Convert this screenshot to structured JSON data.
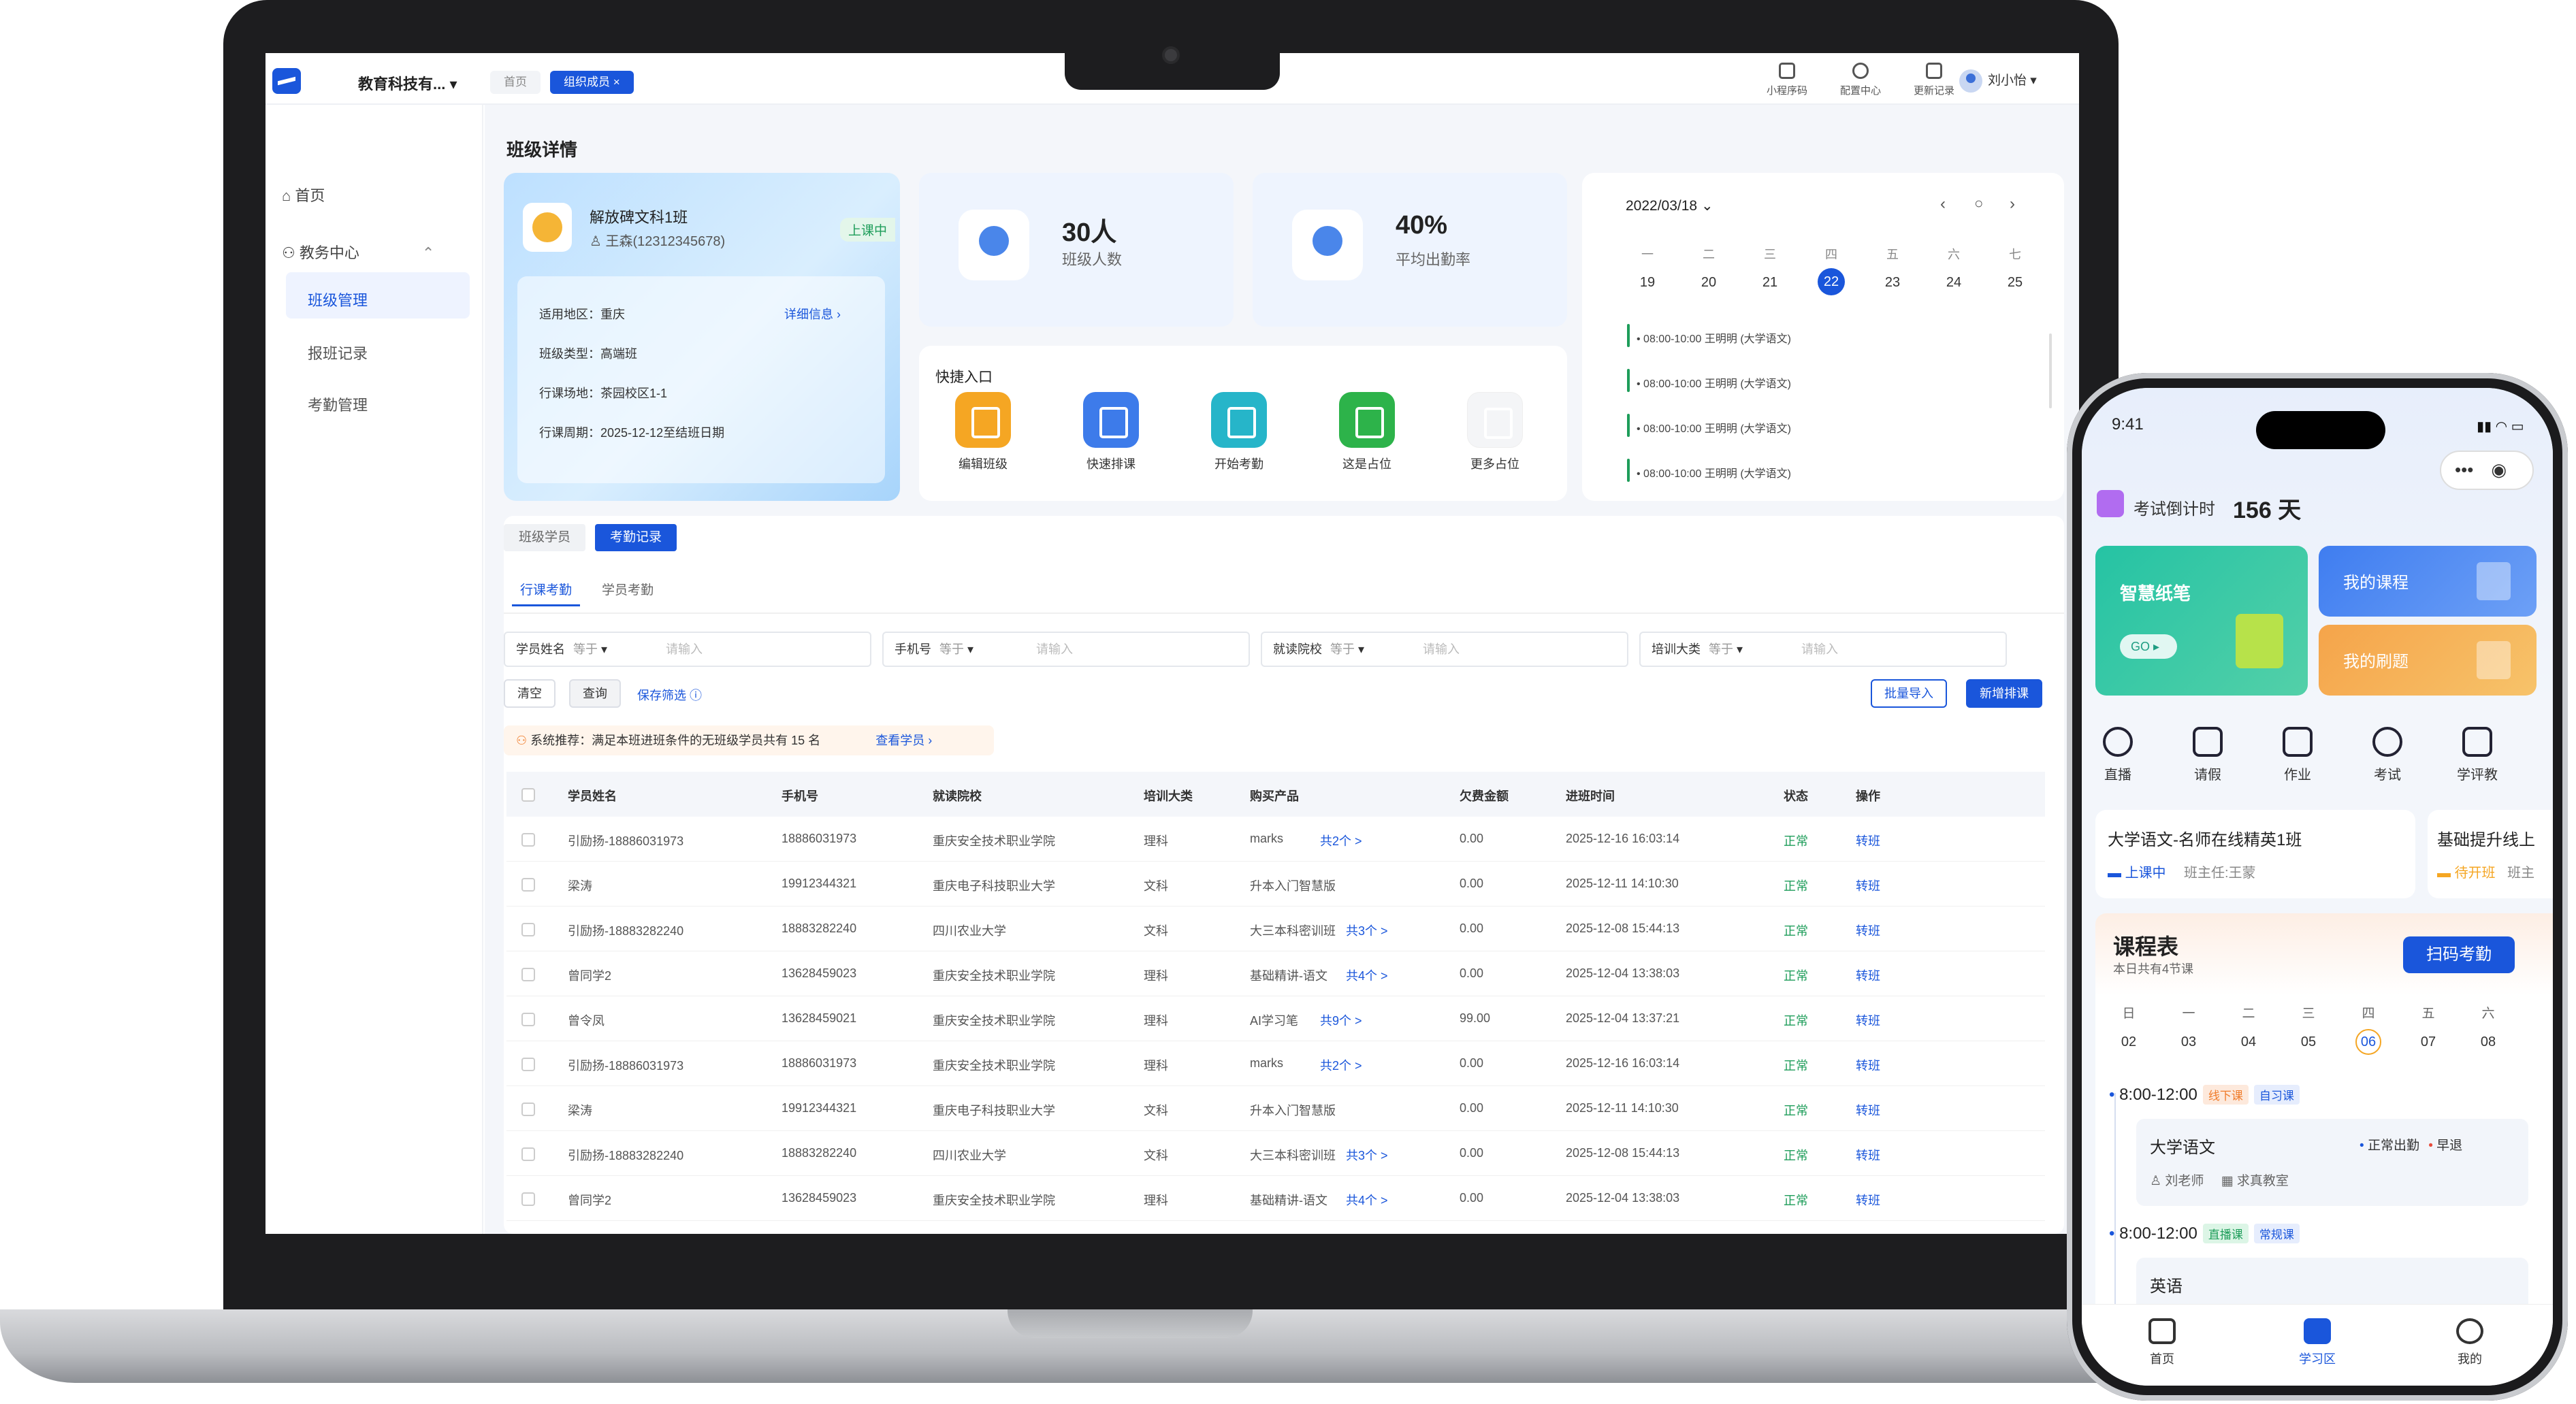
{
  "topbar": {
    "org": "教育科技有...",
    "tab_home": "首页",
    "tab_active": "组织成员",
    "tab_close": "×",
    "icons": [
      {
        "label": "小程序码",
        "icon": "qrcode-icon"
      },
      {
        "label": "配置中心",
        "icon": "cube-icon"
      },
      {
        "label": "更新记录",
        "icon": "document-icon"
      }
    ],
    "user": "刘小怡"
  },
  "sidebar": {
    "home": "首页",
    "group": "教务中心",
    "items": [
      "班级管理",
      "报班记录",
      "考勤管理"
    ]
  },
  "page": {
    "title": "班级详情"
  },
  "class_card": {
    "name": "解放碑文科1班",
    "teacher": "王森(12312345678)",
    "status": "上课中",
    "detail_link": "详细信息",
    "rows": [
      "适用地区：重庆",
      "班级类型：高端班",
      "行课场地：茶园校区1-1",
      "行课周期：2025-12-12至结班日期"
    ]
  },
  "stats": [
    {
      "num": "30人",
      "label": "班级人数"
    },
    {
      "num": "40%",
      "label": "平均出勤率"
    }
  ],
  "quick": {
    "title": "快捷入口",
    "items": [
      {
        "label": "编辑班级",
        "color": "#f5a623"
      },
      {
        "label": "快速排课",
        "color": "#3d7bea"
      },
      {
        "label": "开始考勤",
        "color": "#26b5c9"
      },
      {
        "label": "这是占位",
        "color": "#2db34a"
      },
      {
        "label": "更多占位",
        "color": "#f4f5f7"
      }
    ]
  },
  "calendar": {
    "date": "2022/03/18",
    "weekdays": [
      "一",
      "二",
      "三",
      "四",
      "五",
      "六",
      "七"
    ],
    "days": [
      "19",
      "20",
      "21",
      "22",
      "23",
      "24",
      "25"
    ],
    "selected": "22",
    "events": [
      "• 08:00-10:00 王明明 (大学语文)",
      "• 08:00-10:00 王明明 (大学语文)",
      "• 08:00-10:00 王明明 (大学语文)",
      "• 08:00-10:00 王明明 (大学语文)"
    ]
  },
  "tabs": {
    "seg": [
      "班级学员",
      "考勤记录"
    ],
    "sub": [
      "行课考勤",
      "学员考勤"
    ]
  },
  "filters": [
    {
      "label": "学员姓名",
      "eq": "等于",
      "ph": "请输入"
    },
    {
      "label": "手机号",
      "eq": "等于",
      "ph": "请输入"
    },
    {
      "label": "就读院校",
      "eq": "等于",
      "ph": "请输入"
    },
    {
      "label": "培训大类",
      "eq": "等于",
      "ph": "请输入"
    }
  ],
  "actions": {
    "clear": "清空",
    "query": "查询",
    "save": "保存筛选",
    "import": "批量导入",
    "add": "新增排课"
  },
  "notice": {
    "text": "系统推荐：满足本班进班条件的无班级学员共有 15 名",
    "link": "查看学员"
  },
  "table": {
    "headers": [
      "学员姓名",
      "手机号",
      "就读院校",
      "培训大类",
      "购买产品",
      "欠费金额",
      "进班时间",
      "状态",
      "操作"
    ],
    "rows": [
      [
        "引励扬-18886031973",
        "18886031973",
        "重庆安全技术职业学院",
        "理科",
        "marks",
        "共2个 >",
        "0.00",
        "2025-12-16 16:03:14",
        "正常",
        "转班"
      ],
      [
        "梁涛",
        "19912344321",
        "重庆电子科技职业大学",
        "文科",
        "升本入门智慧版",
        "",
        "0.00",
        "2025-12-11 14:10:30",
        "正常",
        "转班"
      ],
      [
        "引励扬-18883282240",
        "18883282240",
        "四川农业大学",
        "文科",
        "大三本科密训班",
        "共3个 >",
        "0.00",
        "2025-12-08 15:44:13",
        "正常",
        "转班"
      ],
      [
        "曾同学2",
        "13628459023",
        "重庆安全技术职业学院",
        "理科",
        "基础精讲-语文",
        "共4个 >",
        "0.00",
        "2025-12-04 13:38:03",
        "正常",
        "转班"
      ],
      [
        "曾令凤",
        "13628459021",
        "重庆安全技术职业学院",
        "理科",
        "AI学习笔",
        "共9个 >",
        "99.00",
        "2025-12-04 13:37:21",
        "正常",
        "转班"
      ],
      [
        "引励扬-18886031973",
        "18886031973",
        "重庆安全技术职业学院",
        "理科",
        "marks",
        "共2个 >",
        "0.00",
        "2025-12-16 16:03:14",
        "正常",
        "转班"
      ],
      [
        "梁涛",
        "19912344321",
        "重庆电子科技职业大学",
        "文科",
        "升本入门智慧版",
        "",
        "0.00",
        "2025-12-11 14:10:30",
        "正常",
        "转班"
      ],
      [
        "引励扬-18883282240",
        "18883282240",
        "四川农业大学",
        "文科",
        "大三本科密训班",
        "共3个 >",
        "0.00",
        "2025-12-08 15:44:13",
        "正常",
        "转班"
      ],
      [
        "曾同学2",
        "13628459023",
        "重庆安全技术职业学院",
        "理科",
        "基础精讲-语文",
        "共4个 >",
        "0.00",
        "2025-12-04 13:38:03",
        "正常",
        "转班"
      ]
    ]
  },
  "phone": {
    "time": "9:41",
    "countdown_label": "考试倒计时",
    "countdown": "156 天",
    "tiles": [
      {
        "label": "智慧纸笔",
        "btn": "GO"
      },
      {
        "label": "我的课程"
      },
      {
        "label": "我的刷题"
      }
    ],
    "icons": [
      "直播",
      "请假",
      "作业",
      "考试",
      "学评教"
    ],
    "course": {
      "title": "大学语文-名师在线精英1班",
      "status": "上课中",
      "teacher": "班主任:王蒙",
      "title2": "基础提升线上",
      "status2": "待开班",
      "teacher2": "班主"
    },
    "schedule": {
      "title": "课程表",
      "sub": "本日共有4节课",
      "scan": "扫码考勤",
      "weekdays": [
        "日",
        "一",
        "二",
        "三",
        "四",
        "五",
        "六"
      ],
      "days": [
        "02",
        "03",
        "04",
        "05",
        "06",
        "07",
        "08"
      ],
      "selected": "06",
      "item1": {
        "time": "8:00-12:00",
        "tags": [
          "线下课",
          "自习课"
        ],
        "name": "大学语文",
        "att": "正常出勤",
        "late": "早退",
        "teacher": "刘老师",
        "room": "求真教室"
      },
      "item2": {
        "time": "8:00-12:00",
        "tags": [
          "直播课",
          "常规课"
        ],
        "name": "英语"
      }
    },
    "nav": [
      "首页",
      "学习区",
      "我的"
    ]
  }
}
